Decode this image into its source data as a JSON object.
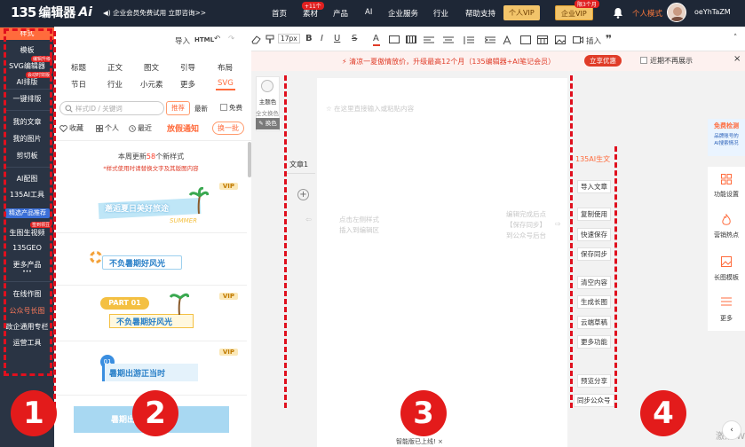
{
  "topbar": {
    "logo_num": "135",
    "logo_text": "编辑器",
    "logo_ai": "Ai",
    "promo": "◀) 企业会员免费试用 立即咨询>>",
    "nav": [
      "首页",
      "素材",
      "产品",
      "AI",
      "企业服务",
      "行业",
      "帮助支持"
    ],
    "nav_badge": "+11个",
    "vip_personal": "个人VIP",
    "vip_corp": "企业VIP",
    "vip_badge": "限3个月",
    "mode": "个人模式",
    "username": "oeYhTaZM"
  },
  "leftnav": {
    "items": [
      "样式",
      "模板",
      "SVG编辑器",
      "AI排版",
      "一键排版",
      "我的文章",
      "我的图片",
      "剪切板",
      "AI配图",
      "135AI工具",
      "精选产品推荐",
      "生图生视频",
      "135GEO",
      "更多产品",
      "在线作图",
      "公众号长图",
      "政企通用专栏",
      "运营工具"
    ],
    "badges": {
      "svg": "编辑升级",
      "ai": "会动时效版",
      "video": "签到领豆"
    },
    "more_dots": "•••"
  },
  "stylepanel": {
    "cats_row1": [
      "标题",
      "正文",
      "图文",
      "引导",
      "布局"
    ],
    "cats_row2": [
      "节日",
      "行业",
      "小元素",
      "更多",
      "SVG"
    ],
    "search_placeholder": "样式ID / 关键词",
    "pill_recommend": "推荐",
    "pill_latest": "最新",
    "pill_free": "免费",
    "tags": [
      "收藏",
      "个人",
      "最近"
    ],
    "holiday": "放假通知",
    "swap": "换一批",
    "update_prefix": "本周更新",
    "update_count": "58",
    "update_suffix": "个新样式",
    "update_note": "*样式使用时请替换文字及其版图内容",
    "vip": "VIP",
    "cards": [
      "邂逅夏日美好旅途",
      "不负暑期好风光",
      "PART 01",
      "不负暑期好风光",
      "01",
      "暑期出游正当时",
      "暑期出游正当时"
    ],
    "card_sub": "SUMMER"
  },
  "toolbar": {
    "import": "导入",
    "html": "HTML",
    "font_size": "17px",
    "insert": "插入",
    "B": "B",
    "I": "I",
    "U": "U",
    "S": "S",
    "A": "A"
  },
  "notice": {
    "text": "⚡ 清凉一夏傲情放价，升级最高12个月（135编辑器+AI笔记会员）",
    "button": "立享优惠",
    "checkbox": "近期不再展示"
  },
  "editor": {
    "theme_color": "主题色",
    "full_text_color": "全文换色",
    "color_btn": "✎ 换色",
    "doc_tab": "文章1",
    "placeholder_top": "☆ 在这里直接输入或粘贴内容",
    "placeholder_left1": "点击左侧样式",
    "placeholder_left2": "插入到编辑区",
    "placeholder_right1": "编辑完成后点",
    "placeholder_right2": "【保存同步】",
    "placeholder_right3": "到公众号后台",
    "status": "智能版已上线! ×"
  },
  "rightbtns": [
    "导入文章",
    "复制使用",
    "快速保存",
    "保存同步",
    "清空内容",
    "生成长图",
    "云端草稿",
    "更多功能",
    "预览分享",
    "同步公众号"
  ],
  "ai_label": "135AI生文",
  "rightpanel": {
    "ad_line1": "免费检测",
    "ad_line2": "品牌账号的",
    "ad_line3": "AI搜索情况",
    "items": [
      "功能设置",
      "营销热点",
      "长图模板",
      "更多"
    ]
  },
  "watermark": "激活 W",
  "numbers": [
    "1",
    "2",
    "3",
    "4"
  ],
  "colors": {
    "accent": "#ff6b3c",
    "topbar": "#1e2736",
    "leftnav": "#2a3444",
    "red_overlay": "#e0101e"
  }
}
